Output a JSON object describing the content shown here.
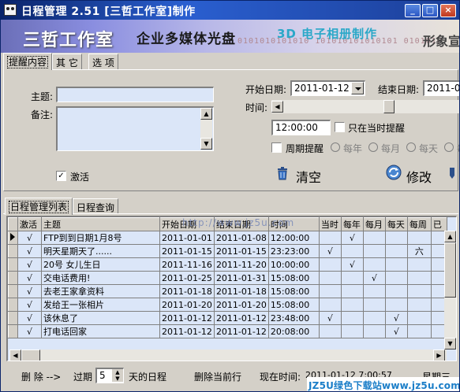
{
  "window": {
    "title": "日程管理 2.51   [三哲工作室]制作",
    "buttons": {
      "minimize": "_",
      "maximize": "□",
      "close": "×"
    }
  },
  "banner": {
    "studio": "三哲工作室",
    "slogan": "企业多媒体光盘",
    "album": "3D 电子相册制作",
    "right_text": "形象宣",
    "binary": "0101010101010 101010101010101 0101010"
  },
  "tabs": {
    "reminder": "提醒内容",
    "other": "其 它",
    "options": "选 项"
  },
  "form": {
    "subject_label": "主题:",
    "subject_value": "",
    "note_label": "备注:",
    "note_value": "",
    "start_date_label": "开始日期:",
    "start_date_value": "2011-01-12",
    "end_date_label": "结束日期:",
    "end_date_value": "2011-0",
    "time_label": "时间:",
    "time_value": "12:00:00",
    "time_slider_level_percent": 60,
    "only_current_label": "只在当时提醒",
    "only_current_checked": false,
    "periodic_label": "周期提醒",
    "periodic_checked": false,
    "period_options": [
      "每年",
      "每月",
      "每天",
      "每"
    ],
    "activate_label": "激活",
    "activate_checked": true,
    "activate_check_mark": "✓"
  },
  "actions": {
    "clear": "清空",
    "modify": "修改"
  },
  "grid_tabs": {
    "list": "日程管理列表",
    "query": "日程查询"
  },
  "grid": {
    "url_overlay": "http://www.jz5u.com",
    "columns": [
      "激活",
      "主题",
      "开始日期",
      "结束日期",
      "时间",
      "当时",
      "每年",
      "每月",
      "每天",
      "每周",
      "已"
    ],
    "rows": [
      {
        "active": "√",
        "subject": "FTP到到日期1月8号",
        "start": "2011-01-01",
        "end": "2011-01-08",
        "time": "12:00:00",
        "cur": "",
        "yearly": "√",
        "monthly": "",
        "daily": "",
        "weekly": "",
        "done": ""
      },
      {
        "active": "√",
        "subject": "明天星期天了......",
        "start": "2011-01-15",
        "end": "2011-01-15",
        "time": "23:23:00",
        "cur": "√",
        "yearly": "",
        "monthly": "",
        "daily": "",
        "weekly": "六",
        "done": ""
      },
      {
        "active": "√",
        "subject": "20号  女儿生日",
        "start": "2011-11-16",
        "end": "2011-11-20",
        "time": "10:00:00",
        "cur": "",
        "yearly": "√",
        "monthly": "",
        "daily": "",
        "weekly": "",
        "done": ""
      },
      {
        "active": "√",
        "subject": "交电话费用!",
        "start": "2011-01-25",
        "end": "2011-01-31",
        "time": "15:08:00",
        "cur": "",
        "yearly": "",
        "monthly": "√",
        "daily": "",
        "weekly": "",
        "done": ""
      },
      {
        "active": "√",
        "subject": "去老王家拿资料",
        "start": "2011-01-18",
        "end": "2011-01-18",
        "time": "15:08:00",
        "cur": "",
        "yearly": "",
        "monthly": "",
        "daily": "",
        "weekly": "",
        "done": ""
      },
      {
        "active": "√",
        "subject": "发给王一张相片",
        "start": "2011-01-20",
        "end": "2011-01-20",
        "time": "15:08:00",
        "cur": "",
        "yearly": "",
        "monthly": "",
        "daily": "",
        "weekly": "",
        "done": ""
      },
      {
        "active": "√",
        "subject": "该休息了",
        "start": "2011-01-12",
        "end": "2011-01-12",
        "time": "23:48:00",
        "cur": "√",
        "yearly": "",
        "monthly": "",
        "daily": "√",
        "weekly": "",
        "done": ""
      },
      {
        "active": "√",
        "subject": "打电话回家",
        "start": "2011-01-12",
        "end": "2011-01-12",
        "time": "20:08:00",
        "cur": "",
        "yearly": "",
        "monthly": "",
        "daily": "√",
        "weekly": "",
        "done": ""
      }
    ]
  },
  "status": {
    "delete_label": "删  除  -->",
    "expired_label": "过期",
    "days_value": "5",
    "days_label": "天的日程",
    "delete_current": "删除当前行",
    "now_label": "现在时间:",
    "now_value": "2011-01-12 7:00:57",
    "weekday": "星期三"
  },
  "watermark": {
    "text": "JZ5U绿色下载站www.jz5u.com"
  },
  "colors": {
    "title_bar": "#0a246a",
    "field_bg": "#dbe6f8",
    "dialog_bg": "#d4d0c8"
  }
}
